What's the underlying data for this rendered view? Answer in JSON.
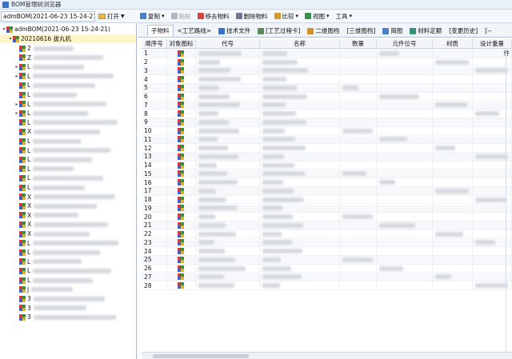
{
  "window": {
    "title": "BOM管理树浏览器"
  },
  "left_toolbar": {
    "combo_value": "admBOM(2021-06-23 15-24-21)",
    "open_label": "打开"
  },
  "tree": {
    "root_label": "admBOM(2021-06-23 15-24-21)",
    "selected_label": "20210616 拔丸机",
    "child_prefixes": [
      "2",
      "Z",
      "L",
      "L",
      "L",
      "L",
      "L",
      "L",
      "L",
      "X",
      "L",
      "L",
      "L",
      "L",
      "L",
      "L",
      "X",
      "X",
      "X",
      "X",
      "X",
      "L",
      "L",
      "L",
      "L",
      "L",
      "J",
      "3",
      "3",
      "3"
    ]
  },
  "toolbar": {
    "items": [
      {
        "label": "复制",
        "dropdown": true,
        "disabled": false,
        "icon": "copy-icon",
        "color": "#4a7fc8"
      },
      {
        "label": "粘贴",
        "dropdown": false,
        "disabled": true,
        "icon": "paste-icon",
        "color": "#b0b8c4"
      },
      {
        "label": "移去物料",
        "dropdown": false,
        "disabled": false,
        "icon": "remove-material-icon",
        "color": "#d64545"
      },
      {
        "label": "删除物料",
        "dropdown": false,
        "disabled": false,
        "icon": "delete-material-icon",
        "color": "#6b7a90"
      },
      {
        "label": "比较",
        "dropdown": true,
        "disabled": false,
        "icon": "compare-icon",
        "color": "#d49a2a"
      },
      {
        "label": "视图",
        "dropdown": true,
        "disabled": false,
        "icon": "view-icon",
        "color": "#3a8f4a"
      },
      {
        "label": "工具",
        "dropdown": true,
        "disabled": false,
        "icon": "",
        "color": ""
      }
    ]
  },
  "tabs": [
    {
      "label": "子物料",
      "active": true
    },
    {
      "label": "<工艺路线>",
      "active": false
    },
    {
      "label": "技术文件",
      "active": false
    },
    {
      "label": "[工艺过程卡]",
      "active": false
    },
    {
      "label": "二维图档",
      "active": false
    },
    {
      "label": "[三维图档]",
      "active": false
    },
    {
      "label": "简图",
      "active": false
    },
    {
      "label": "材料定额",
      "active": false
    },
    {
      "label": "[变更历史]",
      "active": false
    },
    {
      "label": "[--",
      "active": false
    }
  ],
  "table": {
    "columns": [
      "顺序号",
      "对象图标",
      "代号",
      "名称",
      "数量",
      "元件位号",
      "材质",
      "设计重量"
    ],
    "extra_cell": "件",
    "rows": [
      "1",
      "2",
      "3",
      "4",
      "5",
      "6",
      "7",
      "8",
      "9",
      "10",
      "11",
      "12",
      "13",
      "14",
      "15",
      "16",
      "17",
      "18",
      "19",
      "20",
      "21",
      "22",
      "23",
      "24",
      "25",
      "26",
      "27",
      "28"
    ]
  }
}
